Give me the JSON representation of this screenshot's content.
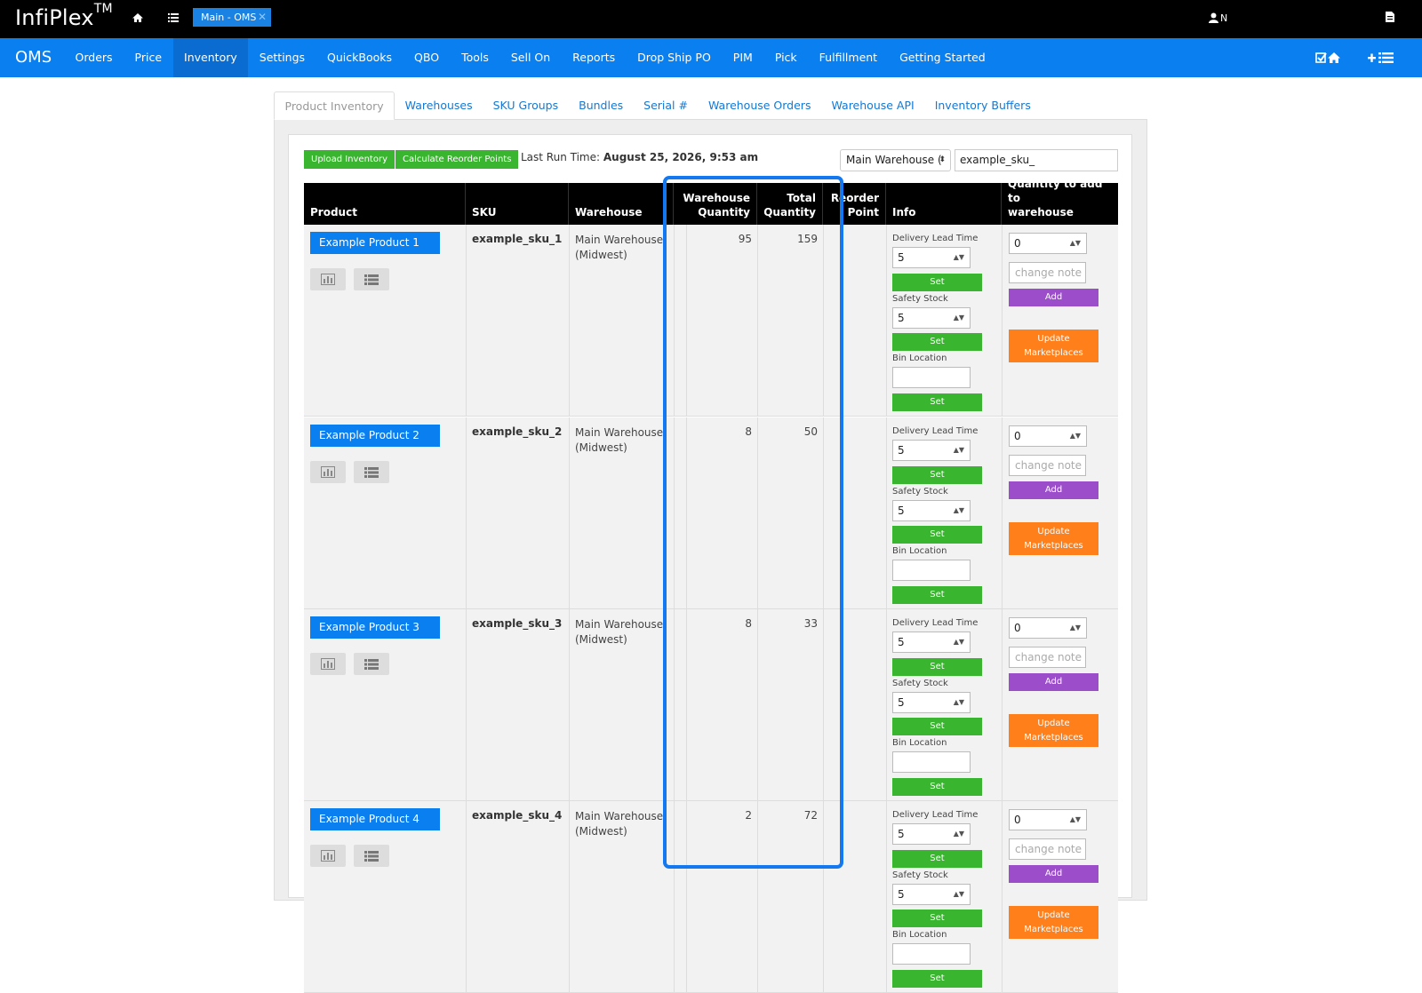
{
  "topbar": {
    "brand": "InfiPlex",
    "brand_tm": "TM",
    "session_tab": "Main - OMS",
    "session_close": "✕",
    "user_initial": "N"
  },
  "nav": {
    "brand": "OMS",
    "items": [
      "Orders",
      "Price",
      "Inventory",
      "Settings",
      "QuickBooks",
      "QBO",
      "Tools",
      "Sell On",
      "Reports",
      "Drop Ship PO",
      "PIM",
      "Pick",
      "Fulfillment",
      "Getting Started"
    ],
    "active": "Inventory"
  },
  "subtabs": [
    "Product Inventory",
    "Warehouses",
    "SKU Groups",
    "Bundles",
    "Serial #",
    "Warehouse Orders",
    "Warehouse API",
    "Inventory Buffers"
  ],
  "toolbar": {
    "upload_label": "Upload Inventory",
    "calc_label": "Calculate Reorder Points",
    "last_run_label": "Last Run Time:",
    "last_run_value": "August 25, 2026, 9:53 am",
    "warehouse_select": "Main Warehouse (",
    "sku_search": "example_sku_"
  },
  "table": {
    "headers": {
      "product": "Product",
      "sku": "SKU",
      "warehouse": "Warehouse",
      "wh_qty_1": "Warehouse",
      "wh_qty_2": "Quantity",
      "total_1": "Total",
      "total_2": "Quantity",
      "reorder_1": "Reorder",
      "reorder_2": "Point",
      "info": "Info",
      "add_1": "Quantity to add to",
      "add_2": "warehouse"
    },
    "labels": {
      "lead_time": "Delivery Lead Time",
      "safety_stock": "Safety Stock",
      "bin_location": "Bin Location",
      "set": "Set",
      "add": "Add",
      "update_1": "Update",
      "update_2": "Marketplaces",
      "note_placeholder": "change note"
    },
    "rows": [
      {
        "product": "Example Product 1",
        "sku": "example_sku_1",
        "warehouse_1": "Main Warehouse",
        "warehouse_2": "(Midwest)",
        "wh_qty": "95",
        "total_qty": "159",
        "lead_time": "5",
        "safety_stock": "5",
        "add_qty": "0"
      },
      {
        "product": "Example Product 2",
        "sku": "example_sku_2",
        "warehouse_1": "Main Warehouse",
        "warehouse_2": "(Midwest)",
        "wh_qty": "8",
        "total_qty": "50",
        "lead_time": "5",
        "safety_stock": "5",
        "add_qty": "0"
      },
      {
        "product": "Example Product 3",
        "sku": "example_sku_3",
        "warehouse_1": "Main Warehouse",
        "warehouse_2": "(Midwest)",
        "wh_qty": "8",
        "total_qty": "33",
        "lead_time": "5",
        "safety_stock": "5",
        "add_qty": "0"
      },
      {
        "product": "Example Product 4",
        "sku": "example_sku_4",
        "warehouse_1": "Main Warehouse",
        "warehouse_2": "(Midwest)",
        "wh_qty": "2",
        "total_qty": "72",
        "lead_time": "5",
        "safety_stock": "5",
        "add_qty": "0"
      }
    ]
  },
  "icons": {
    "home": "home-icon",
    "list": "list-icon",
    "user": "user-icon",
    "doc": "document-icon",
    "chart": "bar-chart-icon",
    "check_home": "checklist-home-icon",
    "plus_list": "plus-list-icon"
  },
  "colors": {
    "nav_blue": "#0a7ff0",
    "set_green": "#3ab530",
    "add_purple": "#9b4dca",
    "update_orange": "#ff7f1a",
    "highlight": "#1478f0"
  }
}
